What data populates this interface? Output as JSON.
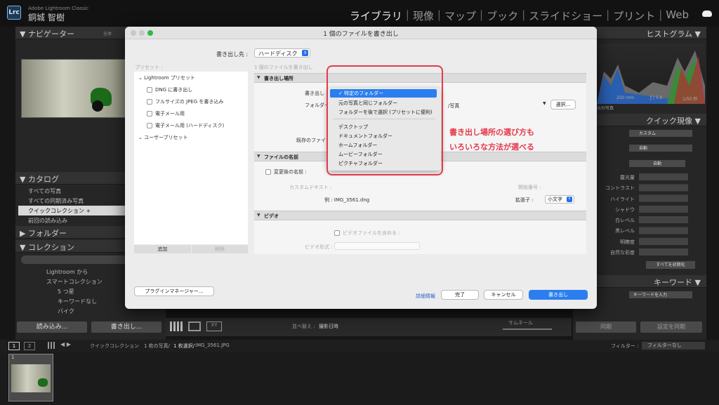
{
  "app": {
    "logo": "Lrc",
    "product": "Adobe Lightroom Classic",
    "user": "銅城 智樹"
  },
  "modules": [
    "ライブラリ",
    "現像",
    "マップ",
    "ブック",
    "スライドショー",
    "プリント",
    "Web"
  ],
  "left": {
    "navigator": "ナビゲーター",
    "navigator_fit": "全体",
    "catalog": "カタログ",
    "catalog_items": [
      "すべての写真",
      "すべての同期済み写真",
      "クイックコレクション +",
      "前回の読み込み"
    ],
    "folders": "フォルダー",
    "collections": "コレクション",
    "col_items": [
      "Lightroom から",
      "スマートコレクション",
      "5 つ星",
      "キーワードなし",
      "バイク"
    ],
    "import": "読み込み...",
    "export": "書き出し..."
  },
  "right": {
    "histogram": "ヒストグラム",
    "focal": "250 mm",
    "fstop": "ƒ / 5.6",
    "shutter": "1/50 秒",
    "orig": "元の写真",
    "quick": "クイック現像",
    "preset_val": "カスタム",
    "wb_val": "自動",
    "auto": "自動",
    "tone_rows": [
      "露光量",
      "コントラスト",
      "ハイライト",
      "シャドウ",
      "白レベル",
      "黒レベル",
      "明瞭度",
      "自然な彩度"
    ],
    "reset": "すべてを初期化",
    "keyword": "キーワード",
    "keyword_val": "キーワードを入力",
    "sync": "同期",
    "sync2": "設定を同期"
  },
  "dialog": {
    "title": "1 個のファイルを書き出し",
    "export_to_label": "書き出し先 :",
    "export_to": "ハードディスク",
    "preset_label": "プリセット :",
    "files_label": "1 個のファイルを書き出し",
    "presets": [
      "Lightroom プリセット",
      "DNG に書き出し",
      "フルサイズの JPEG を書き込み",
      "電子メール用",
      "電子メール用 (ハードディスク)",
      "ユーザープリセット"
    ],
    "add": "追加",
    "remove": "削除",
    "sec_location": "書き出し場所",
    "export_label": "書き出し",
    "folder_label": "フォルダー",
    "existing_label": "既存のファイ",
    "folder_path": "/写真",
    "choose": "選択...",
    "sec_filename": "ファイルの名前",
    "rename_label": "変更後の名前 :",
    "custom_text": "カスタムテキスト :",
    "start_no": "開始番号 :",
    "example": "例 : IMG_3561.dng",
    "ext_label": "拡張子 :",
    "ext_val": "小文字",
    "sec_video": "ビデオ",
    "include_video": "ビデオファイルを含める :",
    "video_format": "ビデオ形式 :",
    "plugin": "プラグインマネージャー...",
    "details": "詳細情報",
    "done": "完了",
    "cancel": "キャンセル",
    "export": "書き出し"
  },
  "menu": [
    "特定のフォルダー",
    "元の写真と同じフォルダー",
    "フォルダーを後で選択 (プリセットに便利)",
    "デスクトップ",
    "ドキュメントフォルダー",
    "ホームフォルダー",
    "ムービーフォルダー",
    "ピクチャフォルダー"
  ],
  "annotation": [
    "書き出し場所の選び方も",
    "いろいろな方法が選べる"
  ],
  "toolbar": {
    "sort_label": "並べ替え :",
    "sort_val": "撮影日時",
    "thumb": "サムネール"
  },
  "filmbar": {
    "p1": "1",
    "p2": "2",
    "path": "クイックコレクション",
    "count": "1 枚の写真/",
    "selected": "1 枚選択/",
    "file": "IMG_3561.JPG",
    "filter_label": "フィルター :",
    "filter_val": "フィルターなし"
  },
  "film": {
    "num": "1"
  }
}
